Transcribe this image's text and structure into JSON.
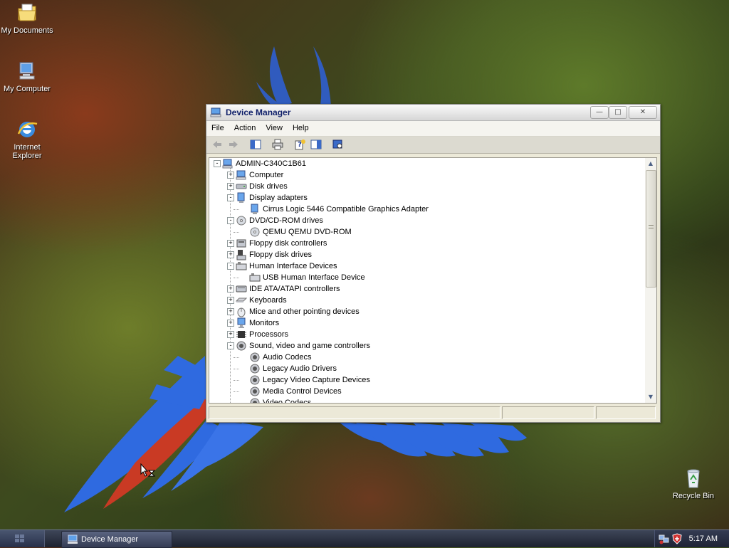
{
  "desktop": {
    "icons": [
      {
        "label": "My Documents"
      },
      {
        "label": "My Computer"
      },
      {
        "label": "Internet Explorer"
      },
      {
        "label": "Recycle Bin"
      }
    ]
  },
  "window": {
    "title": "Device Manager",
    "menu": [
      "File",
      "Action",
      "View",
      "Help"
    ],
    "toolbar": [
      "back-icon",
      "forward-icon",
      "show-hide-tree-icon",
      "print-icon",
      "help-icon",
      "properties-icon",
      "scan-hardware-icon"
    ],
    "tree": [
      {
        "label": "ADMIN-C340C1B61",
        "icon": "computer-icon"
      },
      {
        "label": "Computer",
        "icon": "computer-icon"
      },
      {
        "label": "Disk drives",
        "icon": "disk-drive-icon"
      },
      {
        "label": "Display adapters",
        "icon": "display-adapter-icon"
      },
      {
        "label": "Cirrus Logic 5446 Compatible Graphics Adapter",
        "icon": "display-adapter-icon"
      },
      {
        "label": "DVD/CD-ROM drives",
        "icon": "cdrom-icon"
      },
      {
        "label": "QEMU QEMU DVD-ROM",
        "icon": "cdrom-icon"
      },
      {
        "label": "Floppy disk controllers",
        "icon": "floppy-controller-icon"
      },
      {
        "label": "Floppy disk drives",
        "icon": "floppy-drive-icon"
      },
      {
        "label": "Human Interface Devices",
        "icon": "hid-icon"
      },
      {
        "label": "USB Human Interface Device",
        "icon": "hid-icon"
      },
      {
        "label": "IDE ATA/ATAPI controllers",
        "icon": "ide-controller-icon"
      },
      {
        "label": "Keyboards",
        "icon": "keyboard-icon"
      },
      {
        "label": "Mice and other pointing devices",
        "icon": "mouse-icon"
      },
      {
        "label": "Monitors",
        "icon": "monitor-icon"
      },
      {
        "label": "Processors",
        "icon": "processor-icon"
      },
      {
        "label": "Sound, video and game controllers",
        "icon": "sound-icon"
      },
      {
        "label": "Audio Codecs",
        "icon": "sound-icon"
      },
      {
        "label": "Legacy Audio Drivers",
        "icon": "sound-icon"
      },
      {
        "label": "Legacy Video Capture Devices",
        "icon": "sound-icon"
      },
      {
        "label": "Media Control Devices",
        "icon": "sound-icon"
      },
      {
        "label": "Video Codecs",
        "icon": "sound-icon"
      }
    ]
  },
  "taskbar": {
    "task_label": "Device Manager",
    "clock": "5:17 AM"
  }
}
